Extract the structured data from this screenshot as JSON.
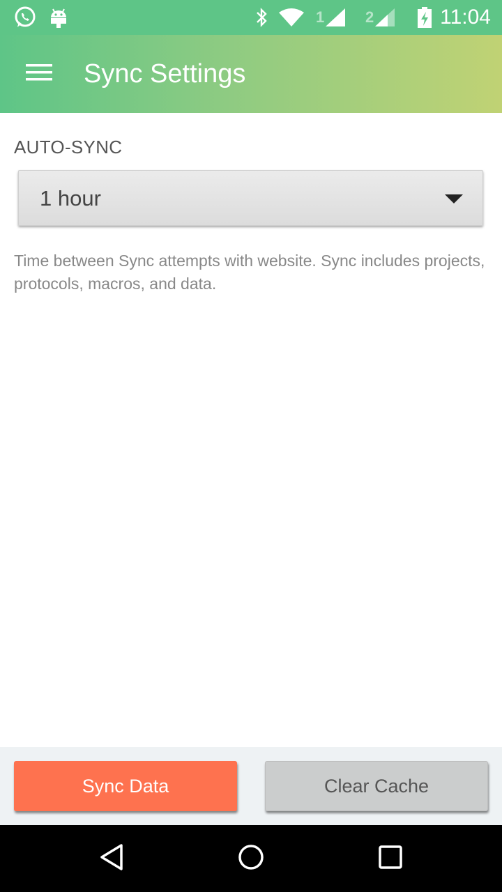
{
  "status_bar": {
    "time": "11:04",
    "sim1_label": "1",
    "sim2_label": "2",
    "icons": [
      "whatsapp-icon",
      "android-icon",
      "bluetooth-icon",
      "wifi-icon",
      "signal-icon",
      "signal-icon",
      "battery-charging-icon"
    ]
  },
  "app_bar": {
    "title": "Sync Settings",
    "menu_icon": "hamburger-menu-icon",
    "gradient": [
      "#5ec587",
      "#c0d274"
    ]
  },
  "auto_sync": {
    "label": "AUTO-SYNC",
    "selected_value": "1 hour",
    "dropdown_icon": "caret-down-icon",
    "helper_text": "Time between Sync attempts with website. Sync includes projects, protocols, macros, and data."
  },
  "actions": {
    "sync_label": "Sync Data",
    "clear_label": "Clear Cache",
    "sync_color": "#fe724f",
    "clear_color": "#cbcdcd"
  },
  "nav": {
    "icons": [
      "back-icon",
      "home-icon",
      "recents-icon"
    ]
  }
}
